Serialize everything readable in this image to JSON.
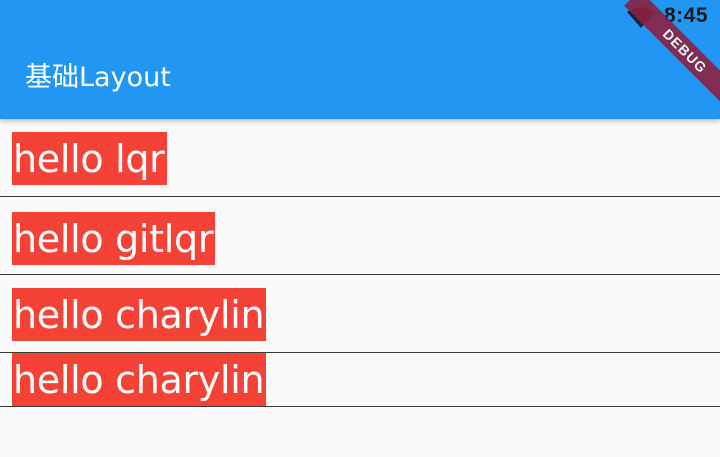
{
  "status_bar": {
    "time": "8:45",
    "wifi_icon": "wifi-icon"
  },
  "app_bar": {
    "title": "基础Layout",
    "background": "#2196f3"
  },
  "debug_banner": {
    "label": "DEBUG",
    "color": "#8d2042"
  },
  "list": {
    "items": [
      {
        "text": "hello lqr"
      },
      {
        "text": "hello gitlqr"
      },
      {
        "text": "hello charylin"
      },
      {
        "text": "hello charylin"
      }
    ],
    "chip_color": "#f44336"
  }
}
